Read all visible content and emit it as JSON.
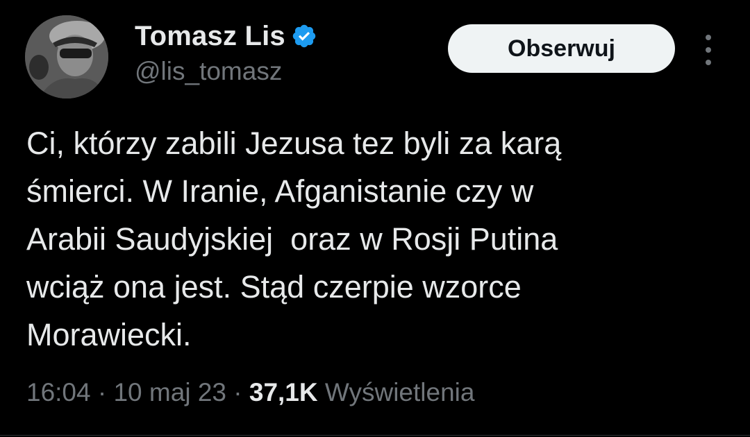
{
  "author": {
    "display_name": "Tomasz Lis",
    "handle": "@lis_tomasz",
    "verified_icon": "verified-badge-icon",
    "verified_color": "#1d9bf0"
  },
  "follow_button": {
    "label": "Obserwuj"
  },
  "more_menu": {
    "icon": "vertical-ellipsis-icon"
  },
  "tweet": {
    "text": "Ci, którzy zabili Jezusa tez byli za karą\nśmierci. W Iranie, Afganistanie czy w\nArabii Saudyjskiej  oraz w Rosji Putina\nwciąż ona jest. Stąd czerpie wzorce\nMorawiecki."
  },
  "meta": {
    "time": "16:04",
    "separator": " · ",
    "date": "10 maj 23",
    "views_count": "37,1K",
    "views_label": " Wyświetlenia"
  },
  "colors": {
    "background": "#000000",
    "text_primary": "#e7e9ea",
    "text_secondary": "#71767b",
    "button_bg": "#eff3f4"
  }
}
